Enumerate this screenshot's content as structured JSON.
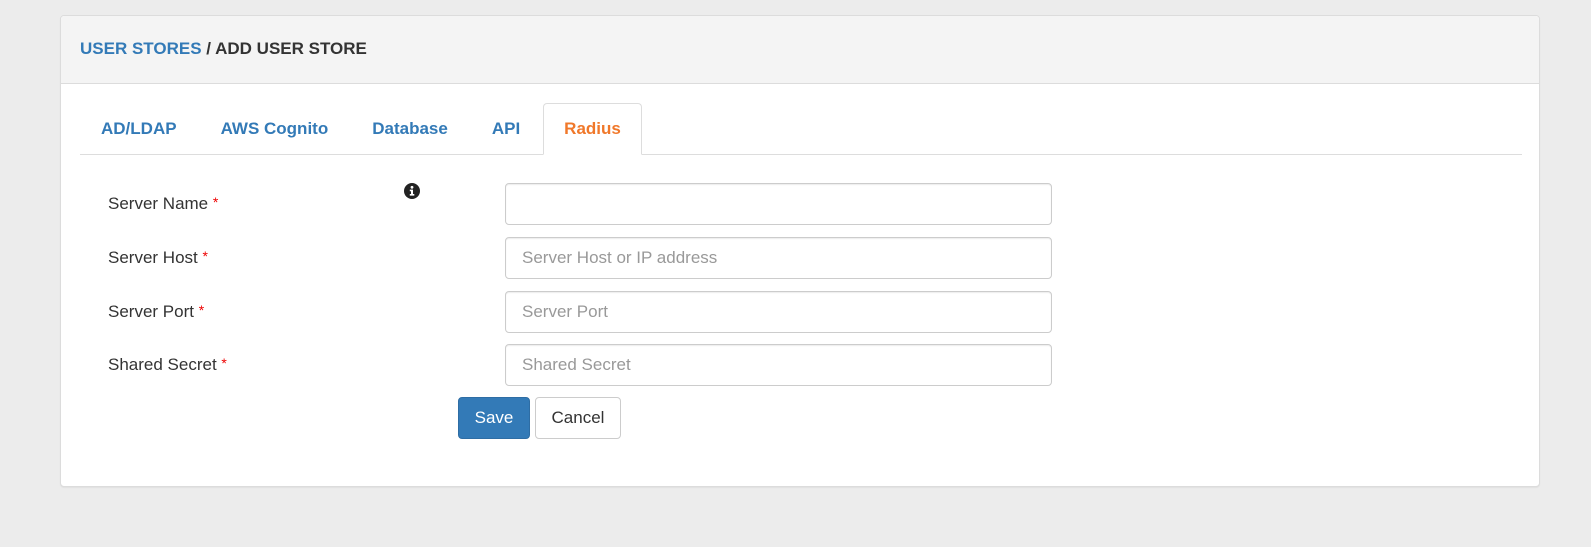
{
  "breadcrumb": {
    "parent": "USER STORES",
    "separator": " / ",
    "current": "ADD USER STORE"
  },
  "tabs": [
    {
      "label": "AD/LDAP",
      "active": false
    },
    {
      "label": "AWS Cognito",
      "active": false
    },
    {
      "label": "Database",
      "active": false
    },
    {
      "label": "API",
      "active": false
    },
    {
      "label": "Radius",
      "active": true
    }
  ],
  "form": {
    "required_marker": "*",
    "info_icon": "info-circle-icon",
    "fields": [
      {
        "label": "Server Name",
        "value": "",
        "placeholder": ""
      },
      {
        "label": "Server Host",
        "value": "",
        "placeholder": "Server Host or IP address"
      },
      {
        "label": "Server Port",
        "value": "",
        "placeholder": "Server Port"
      },
      {
        "label": "Shared Secret",
        "value": "",
        "placeholder": "Shared Secret"
      }
    ],
    "save_label": "Save",
    "cancel_label": "Cancel"
  },
  "colors": {
    "link": "#337ab7",
    "active_tab": "#f0782a",
    "primary_button": "#337ab7",
    "required": "#ee0000"
  }
}
